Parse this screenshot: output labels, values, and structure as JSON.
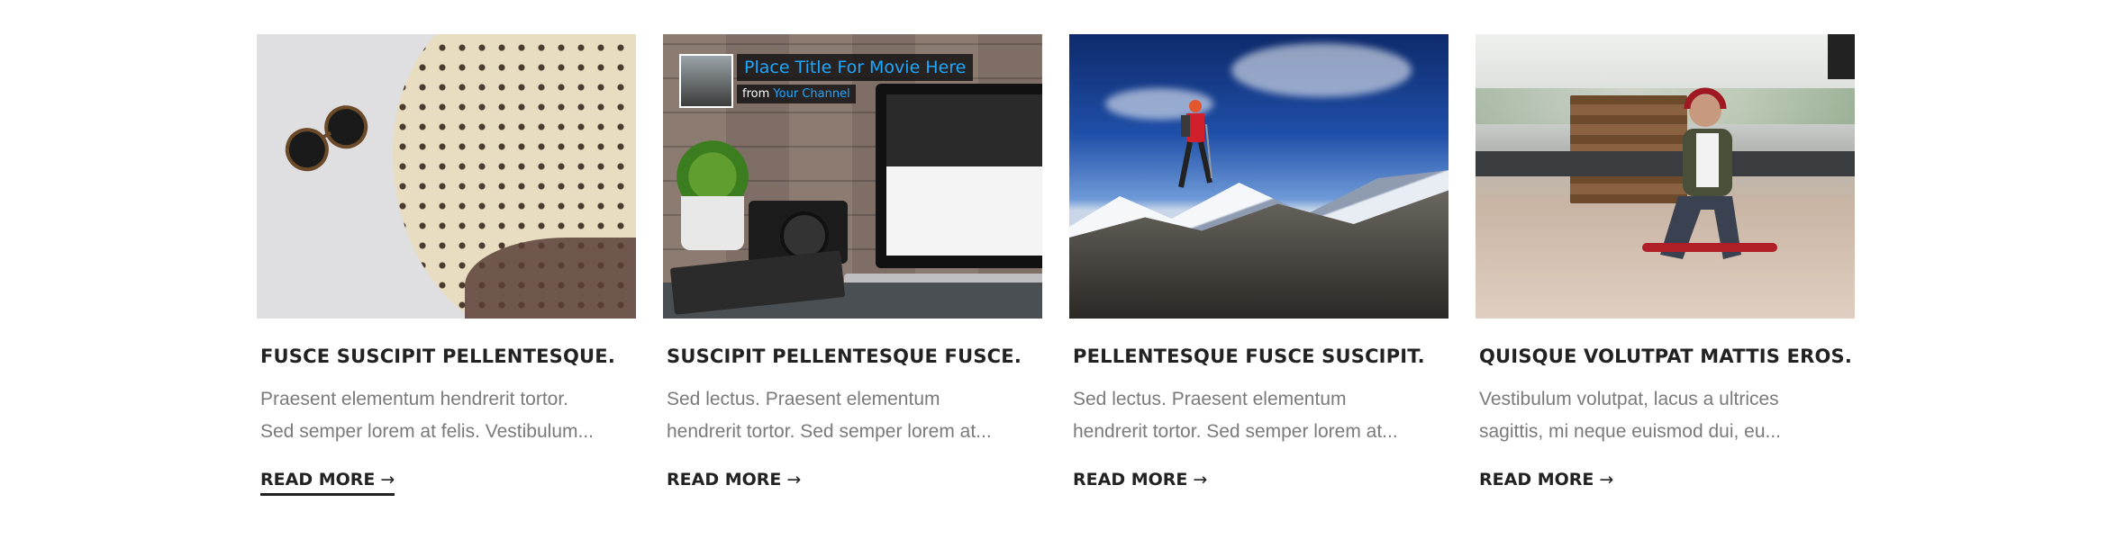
{
  "posts": [
    {
      "title": "FUSCE SUSCIPIT PELLENTESQUE.",
      "excerpt_line1": "Praesent elementum hendrerit tortor.",
      "excerpt_line2": "Sed semper lorem at felis. Vestibulum...",
      "read_more": "READ MORE",
      "image": "sunglasses-and-polka-dot-scarf"
    },
    {
      "title": "SUSCIPIT PELLENTESQUE FUSCE.",
      "excerpt_line1": "Sed lectus. Praesent elementum",
      "excerpt_line2": "hendrerit tortor. Sed semper lorem at...",
      "read_more": "READ MORE",
      "image": "laptop-camera-video-thumbnail",
      "video_overlay": {
        "title": "Place Title For Movie Here",
        "from": "from",
        "channel": "Your Channel"
      }
    },
    {
      "title": "PELLENTESQUE FUSCE SUSCIPIT.",
      "excerpt_line1": "Sed lectus. Praesent elementum",
      "excerpt_line2": "hendrerit tortor. Sed semper lorem at...",
      "read_more": "READ MORE",
      "image": "hiker-on-mountain-rocks"
    },
    {
      "title": "QUISQUE VOLUTPAT MATTIS EROS.",
      "excerpt_line1": "Vestibulum volutpat, lacus a ultrices",
      "excerpt_line2": "sagittis, mi neque euismod dui, eu...",
      "read_more": "READ MORE",
      "image": "man-with-headphones-on-skateboard"
    }
  ],
  "arrow": "→",
  "colors": {
    "title": "#222222",
    "excerpt": "#7a7a7a",
    "video_title": "#1ea7ff"
  }
}
